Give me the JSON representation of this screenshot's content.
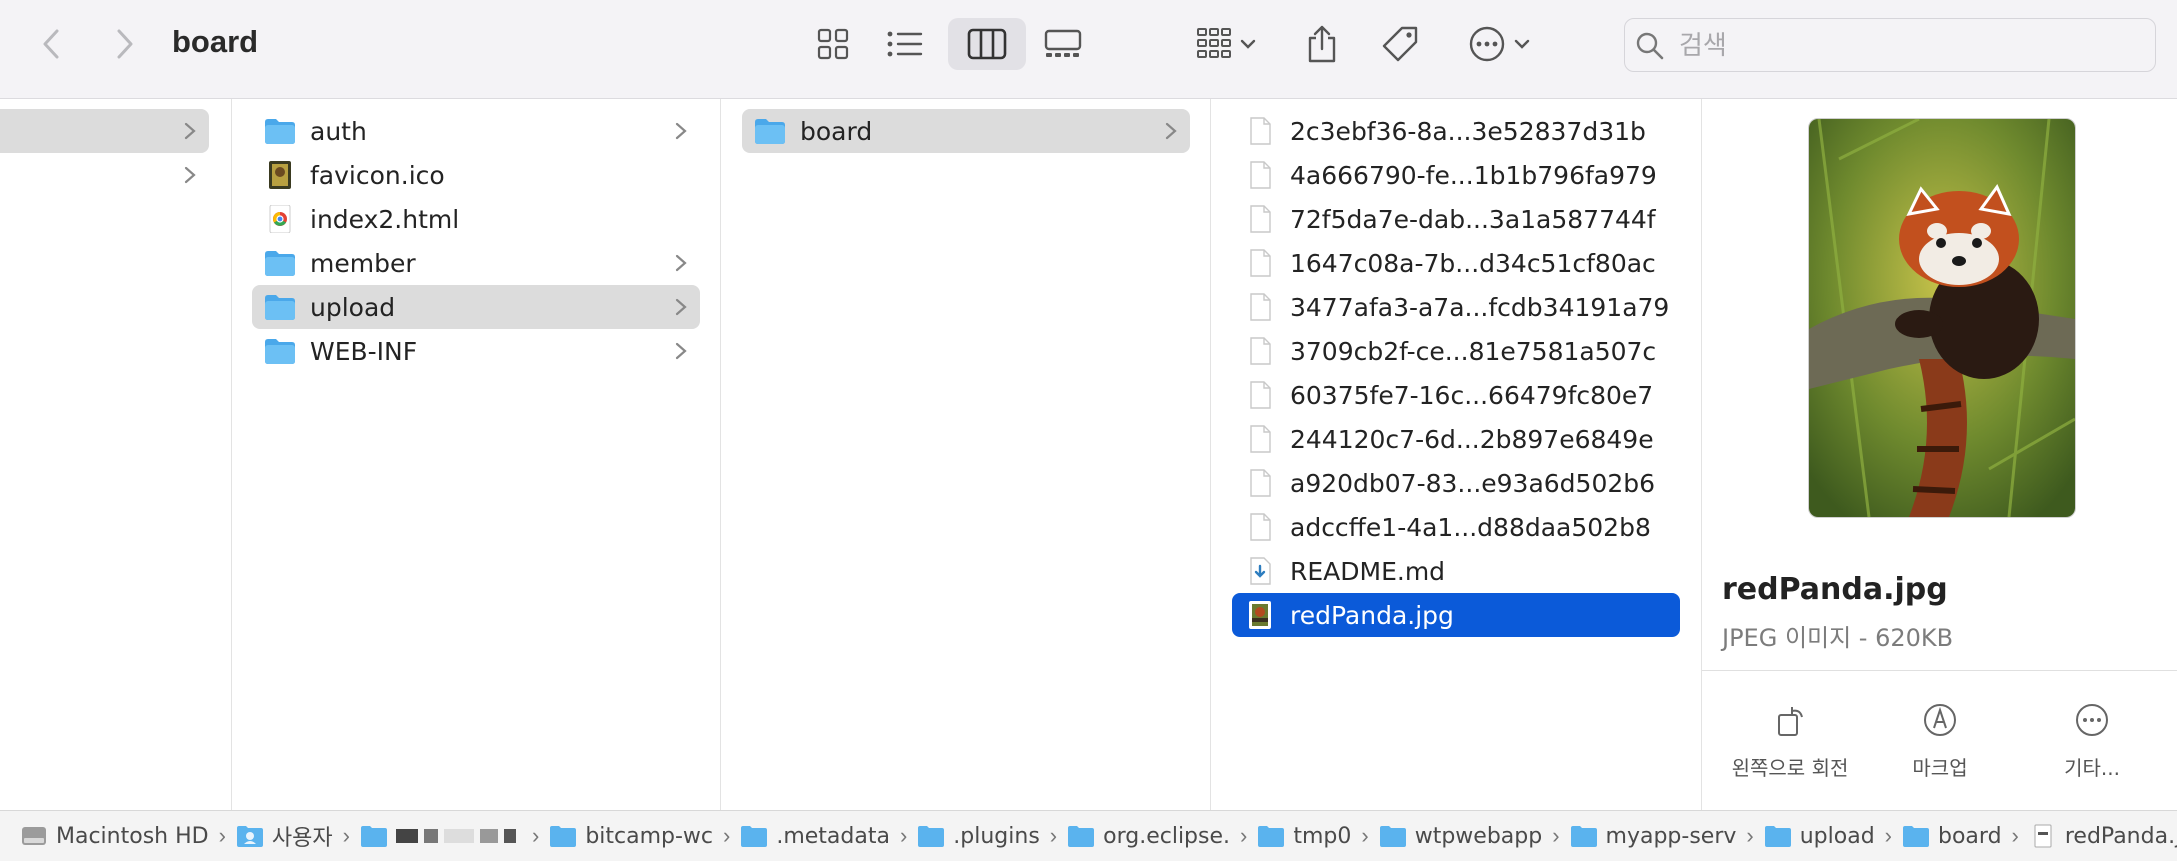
{
  "toolbar": {
    "title": "board",
    "search_placeholder": "검색",
    "active_view": "columns"
  },
  "columns": {
    "col1": {
      "rows": [
        {
          "label": "",
          "selected": true,
          "folder": true
        },
        {
          "label": "",
          "folder": true
        }
      ]
    },
    "col2": {
      "rows": [
        {
          "label": "auth",
          "type": "folder"
        },
        {
          "label": "favicon.ico",
          "type": "image"
        },
        {
          "label": "index2.html",
          "type": "html"
        },
        {
          "label": "member",
          "type": "folder"
        },
        {
          "label": "upload",
          "type": "folder",
          "selected": true
        },
        {
          "label": "WEB-INF",
          "type": "folder"
        }
      ]
    },
    "col3": {
      "rows": [
        {
          "label": "board",
          "type": "folder",
          "selected": true
        }
      ]
    },
    "col4": {
      "rows": [
        {
          "label": "2c3ebf36-8a...3e52837d31b"
        },
        {
          "label": "4a666790-fe...1b1b796fa979"
        },
        {
          "label": "72f5da7e-dab...3a1a587744f"
        },
        {
          "label": "1647c08a-7b...d34c51cf80ac"
        },
        {
          "label": "3477afa3-a7a...fcdb34191a79"
        },
        {
          "label": "3709cb2f-ce...81e7581a507c"
        },
        {
          "label": "60375fe7-16c...66479fc80e7"
        },
        {
          "label": "244120c7-6d...2b897e6849e"
        },
        {
          "label": "a920db07-83...e93a6d502b6"
        },
        {
          "label": "adccffe1-4a1...d88daa502b8"
        },
        {
          "label": "README.md"
        },
        {
          "label": "redPanda.jpg",
          "selected": true
        }
      ]
    }
  },
  "preview": {
    "name": "redPanda.jpg",
    "kind": "JPEG 이미지 - 620KB",
    "actions": [
      {
        "label": "왼쪽으로 회전",
        "icon": "rotate-left-icon"
      },
      {
        "label": "마크업",
        "icon": "markup-icon"
      },
      {
        "label": "기타...",
        "icon": "more-icon"
      }
    ]
  },
  "pathbar": {
    "items": [
      {
        "label": "Macintosh HD",
        "icon": "disk-icon"
      },
      {
        "label": "사용자",
        "icon": "users-folder-icon"
      },
      {
        "label": "",
        "icon": "home-folder-icon"
      },
      {
        "label": "bitcamp-wc",
        "icon": "folder-icon"
      },
      {
        "label": ".metadata",
        "icon": "folder-icon"
      },
      {
        "label": ".plugins",
        "icon": "folder-icon"
      },
      {
        "label": "org.eclipse.",
        "icon": "folder-icon"
      },
      {
        "label": "tmp0",
        "icon": "folder-icon"
      },
      {
        "label": "wtpwebapp",
        "icon": "folder-icon"
      },
      {
        "label": "myapp-serv",
        "icon": "folder-icon"
      },
      {
        "label": "upload",
        "icon": "folder-icon"
      },
      {
        "label": "board",
        "icon": "folder-icon"
      },
      {
        "label": "redPanda.jpg",
        "icon": "jpg-file-icon"
      }
    ]
  },
  "colors": {
    "selection_blue": "#0b5ad9",
    "folder_blue": "#5ab3ee",
    "toolbar_bg": "#f4f3f6"
  }
}
